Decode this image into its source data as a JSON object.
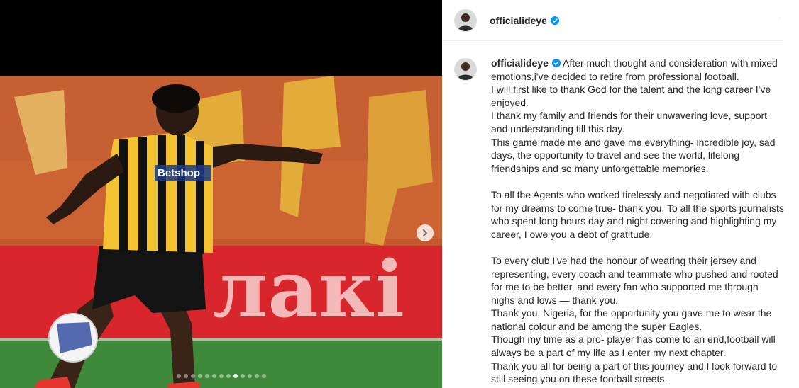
{
  "post": {
    "username": "officialideye",
    "caption_lines_1": [
      "After much thought and consideration with mixed",
      "emotions,i've decided to retire from professional football.",
      "I will first like to thank God for the talent and the long career I've",
      "enjoyed.",
      "I thank my family and friends for their unwavering love, support",
      "and understanding till this day.",
      "This game made me and gave me everything- incredible joy, sad",
      "days, the opportunity to travel and see the world, lifelong",
      "friendships and so many unforgettable memories."
    ],
    "caption_lines_2": [
      "To all the Agents who worked tirelessly and negotiated with clubs",
      "for my dreams to come true- thank you. To all the sports journalists",
      "who spent long hours day and night covering and highlighting my",
      "career, I owe you a debt of gratitude."
    ],
    "caption_lines_3": [
      "To every club I've had the honour of wearing their jersey and",
      "representing, every coach and teammate who pushed and rooted",
      "for me to be better, and every fan who supported me through",
      "highs and lows — thank you.",
      "Thank you, Nigeria, for the opportunity you gave me to wear the",
      "national colour and be among the super Eagles.",
      "Though my time as a pro- player has come to an end,football will",
      "always be a part of my life as I enter my next chapter.",
      "Thank you all for being a part of this journey and I look forward to",
      "still seeing you on these football streets."
    ]
  },
  "media": {
    "jersey_sponsor": "Betshop",
    "banner_text": "лакі",
    "carousel_dot_count": 13,
    "carousel_active_index": 8
  },
  "icons": {
    "verified": "verified-badge-icon",
    "next": "chevron-right-icon"
  },
  "colors": {
    "verified_blue": "#0095f6",
    "jersey_yellow": "#f2c230",
    "jersey_black": "#111111",
    "banner_red": "#d8262c"
  }
}
